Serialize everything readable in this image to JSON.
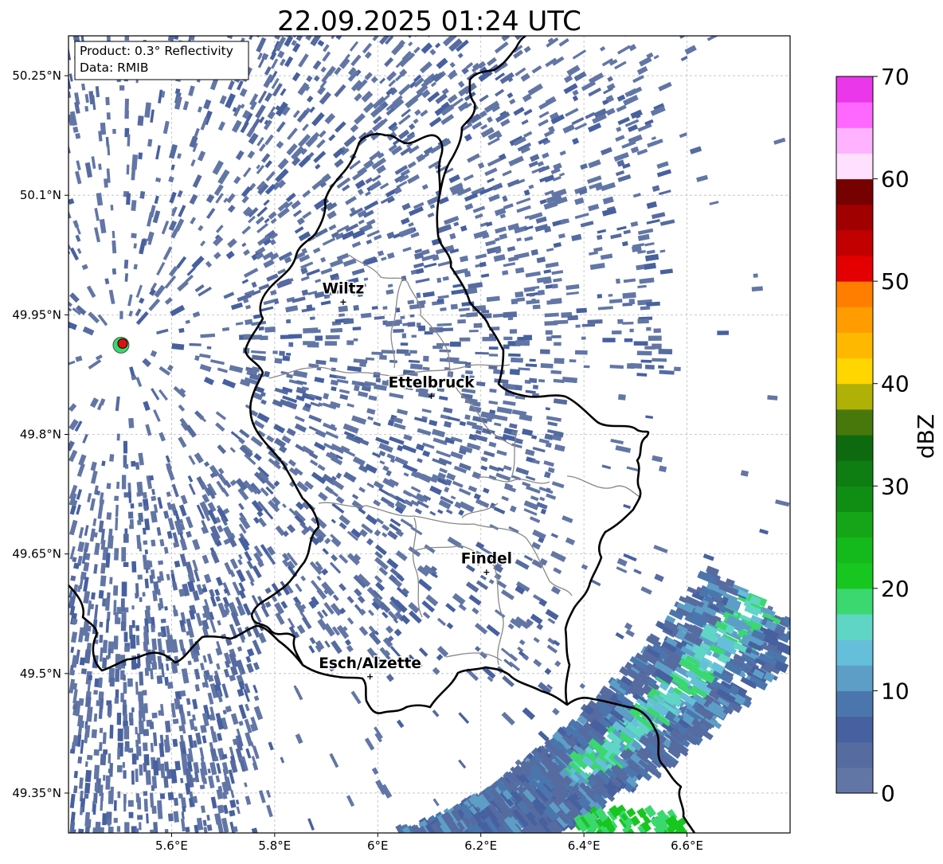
{
  "title": "22.09.2025 01:24 UTC",
  "info_box": {
    "line1": "Product: 0.3° Reflectivity",
    "line2": "Data: RMIB"
  },
  "map": {
    "lon_range": [
      5.4,
      6.8
    ],
    "lat_range": [
      49.3,
      50.3
    ],
    "x_ticks": [
      {
        "value": 5.6,
        "label": "5.6°E"
      },
      {
        "value": 5.8,
        "label": "5.8°E"
      },
      {
        "value": 6.0,
        "label": "6°E"
      },
      {
        "value": 6.2,
        "label": "6.2°E"
      },
      {
        "value": 6.4,
        "label": "6.4°E"
      },
      {
        "value": 6.6,
        "label": "6.6°E"
      }
    ],
    "y_ticks": [
      {
        "value": 50.25,
        "label": "50.25°N"
      },
      {
        "value": 50.1,
        "label": "50.1°N"
      },
      {
        "value": 49.95,
        "label": "49.95°N"
      },
      {
        "value": 49.8,
        "label": "49.8°N"
      },
      {
        "value": 49.65,
        "label": "49.65°N"
      },
      {
        "value": 49.5,
        "label": "49.5°N"
      },
      {
        "value": 49.35,
        "label": "49.35°N"
      }
    ],
    "cities": [
      {
        "name": "Wiltz",
        "lon": 5.933,
        "lat": 49.966
      },
      {
        "name": "Ettelbruck",
        "lon": 6.104,
        "lat": 49.848
      },
      {
        "name": "Findel",
        "lon": 6.211,
        "lat": 49.627
      },
      {
        "name": "Esch/Alzette",
        "lon": 5.985,
        "lat": 49.496
      }
    ],
    "radar_site": {
      "lon": 5.505,
      "lat": 49.914
    },
    "grid": true
  },
  "colorbar": {
    "label": "dBZ",
    "vmin": 0,
    "vmax": 70,
    "step": 2.5,
    "ticks": [
      0,
      10,
      20,
      30,
      40,
      50,
      60,
      70
    ],
    "colors": [
      "#6276a6",
      "#566ba0",
      "#47609f",
      "#4b76ad",
      "#5d9ec7",
      "#66bfda",
      "#5fd6c5",
      "#3ad86e",
      "#17c61f",
      "#14ba1b",
      "#14a616",
      "#0f8e13",
      "#0e7d12",
      "#0d6a0e",
      "#48780c",
      "#afb106",
      "#ffd600",
      "#ffb800",
      "#ff9d00",
      "#ff7e00",
      "#e40000",
      "#c20000",
      "#a00000",
      "#770000",
      "#ffe0ff",
      "#ffb2ff",
      "#ff68ff",
      "#e937e9"
    ]
  }
}
